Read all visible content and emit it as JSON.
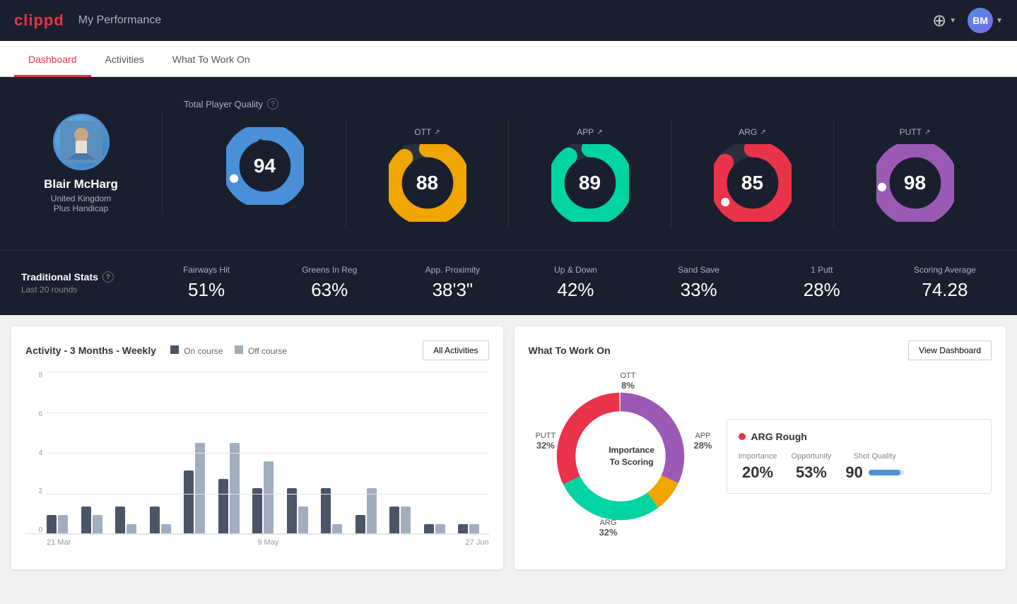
{
  "header": {
    "logo": "clippd",
    "title": "My Performance",
    "add_icon": "⊕",
    "avatar_initials": "BM"
  },
  "nav": {
    "tabs": [
      {
        "label": "Dashboard",
        "active": true
      },
      {
        "label": "Activities",
        "active": false
      },
      {
        "label": "What To Work On",
        "active": false
      }
    ]
  },
  "player": {
    "name": "Blair McHarg",
    "country": "United Kingdom",
    "handicap": "Plus Handicap"
  },
  "total_quality": {
    "title": "Total Player Quality",
    "score": "94",
    "color": "#4a90d9",
    "percentage": 94
  },
  "category_scores": [
    {
      "label": "OTT",
      "value": "88",
      "color": "#f0a500",
      "percentage": 88
    },
    {
      "label": "APP",
      "value": "89",
      "color": "#00d4a0",
      "percentage": 89
    },
    {
      "label": "ARG",
      "value": "85",
      "color": "#e8334a",
      "percentage": 85
    },
    {
      "label": "PUTT",
      "value": "98",
      "color": "#9b59b6",
      "percentage": 98
    }
  ],
  "traditional_stats": {
    "title": "Traditional Stats",
    "subtitle": "Last 20 rounds",
    "stats": [
      {
        "name": "Fairways Hit",
        "value": "51%"
      },
      {
        "name": "Greens In Reg",
        "value": "63%"
      },
      {
        "name": "App. Proximity",
        "value": "38'3\""
      },
      {
        "name": "Up & Down",
        "value": "42%"
      },
      {
        "name": "Sand Save",
        "value": "33%"
      },
      {
        "name": "1 Putt",
        "value": "28%"
      },
      {
        "name": "Scoring Average",
        "value": "74.28"
      }
    ]
  },
  "activity_chart": {
    "title": "Activity - 3 Months - Weekly",
    "legend": {
      "on_course": "On course",
      "off_course": "Off course"
    },
    "button": "All Activities",
    "x_labels": [
      "21 Mar",
      "9 May",
      "27 Jun"
    ],
    "y_labels": [
      "8",
      "6",
      "4",
      "2",
      "0"
    ],
    "bars": [
      {
        "on": 1,
        "off": 1
      },
      {
        "on": 1.5,
        "off": 1
      },
      {
        "on": 1.5,
        "off": 0.5
      },
      {
        "on": 1.5,
        "off": 0.5
      },
      {
        "on": 3.5,
        "off": 5
      },
      {
        "on": 3,
        "off": 5
      },
      {
        "on": 2.5,
        "off": 4
      },
      {
        "on": 2.5,
        "off": 1.5
      },
      {
        "on": 2.5,
        "off": 0.5
      },
      {
        "on": 1,
        "off": 2.5
      },
      {
        "on": 1.5,
        "off": 1.5
      },
      {
        "on": 0.5,
        "off": 0.5
      },
      {
        "on": 0.5,
        "off": 0.5
      }
    ]
  },
  "what_to_work_on": {
    "title": "What To Work On",
    "button": "View Dashboard",
    "donut_center": "Importance\nTo Scoring",
    "segments": [
      {
        "label": "OTT",
        "percentage": "8%",
        "color": "#f0a500",
        "position": "top"
      },
      {
        "label": "APP",
        "percentage": "28%",
        "color": "#00d4a0",
        "position": "right"
      },
      {
        "label": "ARG",
        "percentage": "32%",
        "color": "#e8334a",
        "position": "bottom"
      },
      {
        "label": "PUTT",
        "percentage": "32%",
        "color": "#9b59b6",
        "position": "left"
      }
    ],
    "card": {
      "title": "ARG Rough",
      "importance": "20%",
      "opportunity": "53%",
      "shot_quality": "90",
      "shot_quality_pct": 90
    }
  }
}
